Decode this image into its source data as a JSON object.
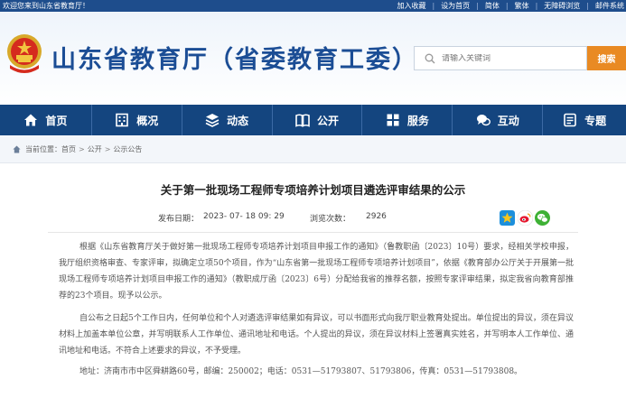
{
  "topbar": {
    "welcome": "欢迎您来到山东省教育厅！",
    "links": [
      "加入收藏",
      "设为首页",
      "简体",
      "繁体",
      "无障碍浏览",
      "邮件系统"
    ]
  },
  "header": {
    "site_title": "山东省教育厅（省委教育工委）",
    "search_placeholder": "请输入关键词",
    "search_button": "搜索"
  },
  "nav": {
    "items": [
      {
        "label": "首页",
        "icon": "home-icon"
      },
      {
        "label": "概况",
        "icon": "building-icon"
      },
      {
        "label": "动态",
        "icon": "layers-icon"
      },
      {
        "label": "公开",
        "icon": "book-icon"
      },
      {
        "label": "服务",
        "icon": "grid-icon"
      },
      {
        "label": "互动",
        "icon": "chat-icon"
      },
      {
        "label": "专题",
        "icon": "list-icon"
      }
    ]
  },
  "breadcrumb": {
    "prefix": "当前位置：",
    "items": [
      "首页",
      "公开",
      "公示公告"
    ],
    "separator": ">"
  },
  "article": {
    "title": "关于第一批现场工程师专项培养计划项目遴选评审结果的公示",
    "publish_label": "发布日期：",
    "publish_date": "2023- 07- 18 09: 29",
    "views_label": "浏览次数：",
    "views": "2926",
    "paragraphs": [
      "根据《山东省教育厅关于做好第一批现场工程师专项培养计划项目申报工作的通知》（鲁教职函〔2023〕10号）要求，经相关学校申报，我厅组织资格审查、专家评审，拟确定立项50个项目，作为“山东省第一批现场工程师专项培养计划项目”，依据《教育部办公厅关于开展第一批现场工程师专项培养计划项目申报工作的通知》（教职成厅函〔2023〕6号）分配给我省的推荐名额，按照专家评审结果，拟定我省向教育部推荐的23个项目。现予以公示。",
      "自公布之日起5个工作日内，任何单位和个人对遴选评审结果如有异议，可以书面形式向我厅职业教育处提出。单位提出的异议，须在异议材料上加盖本单位公章，并写明联系人工作单位、通讯地址和电话。个人提出的异议，须在异议材料上签署真实姓名，并写明本人工作单位、通讯地址和电话。不符合上述要求的异议，不予受理。",
      "地址：济南市市中区舜耕路60号，邮编：250002；电话：0531—51793807、51793806，传真：0531—51793808。"
    ]
  },
  "colors": {
    "topbar": "#1e4d8c",
    "nav": "#14457f",
    "title": "#1b4d95",
    "search_button": "#e98a23"
  }
}
